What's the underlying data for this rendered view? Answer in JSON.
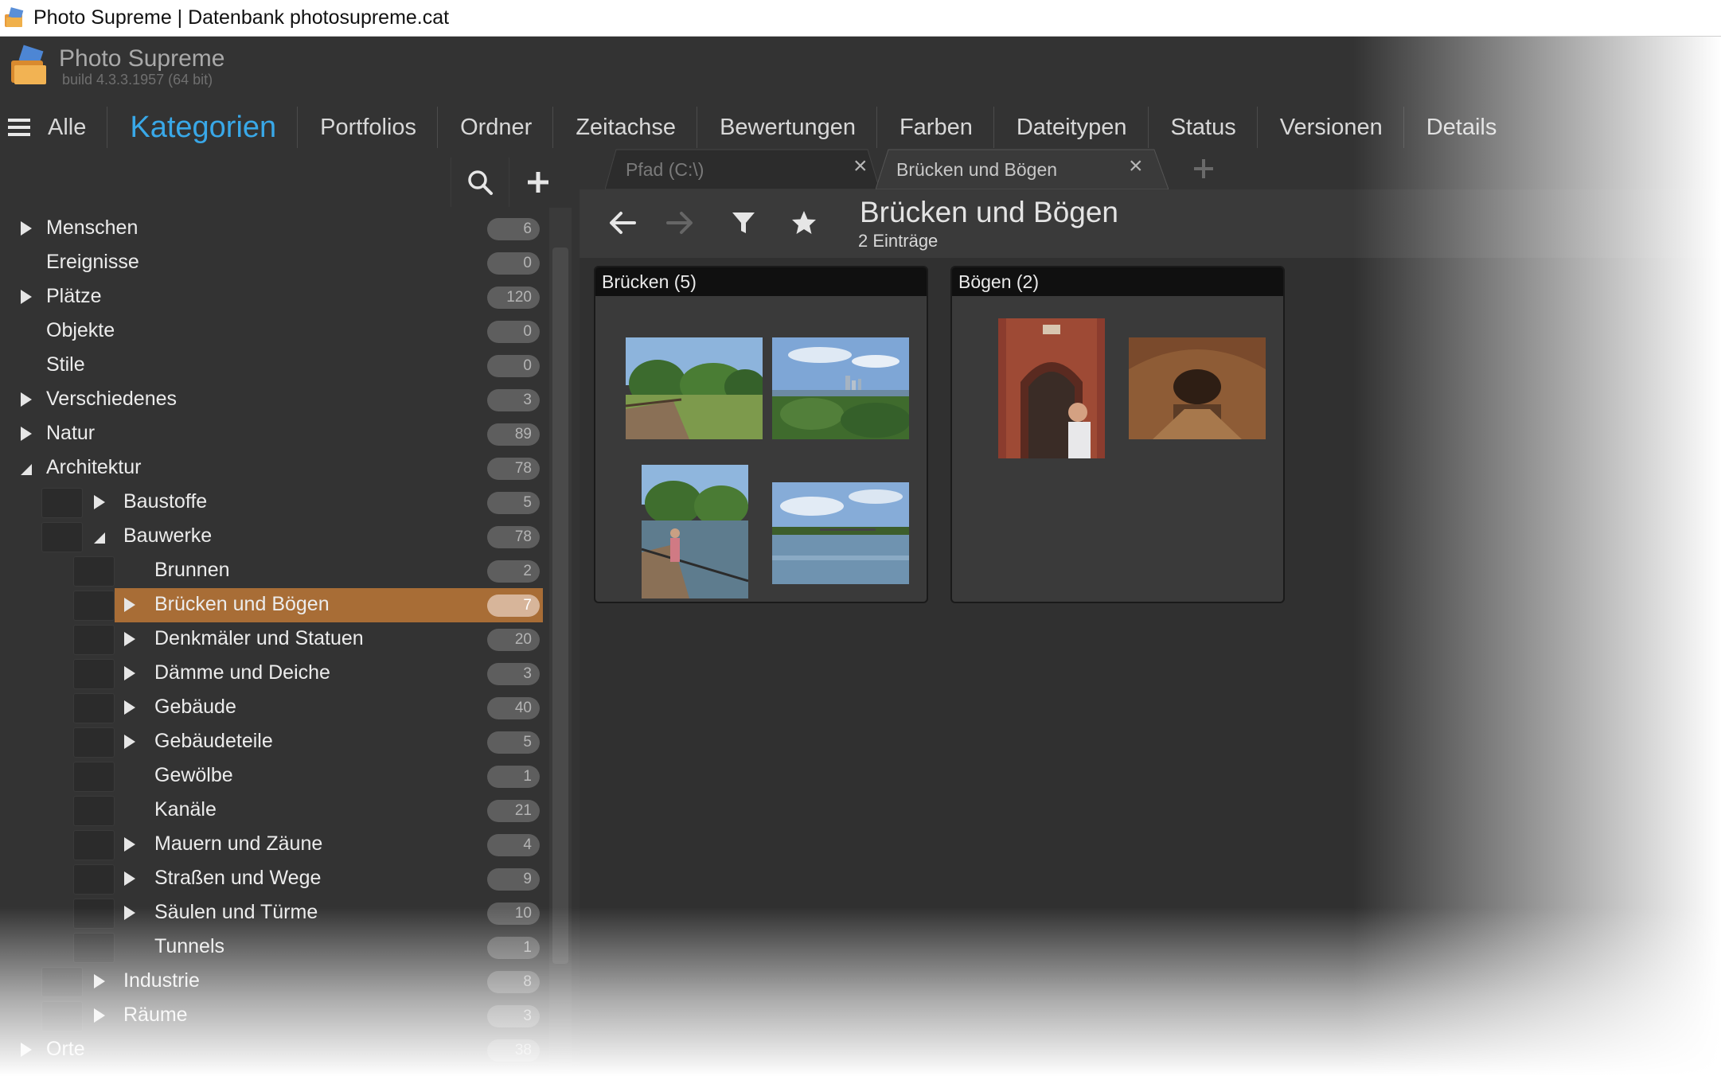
{
  "window": {
    "title": "Photo Supreme | Datenbank photosupreme.cat",
    "icon": "app-logo-icon"
  },
  "brand": {
    "name": "Photo Supreme",
    "build": "build 4.3.3.1957 (64 bit)"
  },
  "nav": {
    "menu_icon": "hamburger-icon",
    "items": [
      {
        "label": "Alle"
      },
      {
        "label": "Kategorien",
        "active": true
      },
      {
        "label": "Portfolios"
      },
      {
        "label": "Ordner"
      },
      {
        "label": "Zeitachse"
      },
      {
        "label": "Bewertungen"
      },
      {
        "label": "Farben"
      },
      {
        "label": "Dateitypen"
      },
      {
        "label": "Status"
      },
      {
        "label": "Versionen"
      },
      {
        "label": "Details"
      }
    ]
  },
  "left_tools": {
    "search_icon": "search-icon",
    "add_icon": "plus-icon"
  },
  "tree": [
    {
      "label": "Menschen",
      "count": "6",
      "level": 0,
      "expander": "collapsed"
    },
    {
      "label": "Ereignisse",
      "count": "0",
      "level": 0,
      "expander": "none"
    },
    {
      "label": "Plätze",
      "count": "120",
      "level": 0,
      "expander": "collapsed"
    },
    {
      "label": "Objekte",
      "count": "0",
      "level": 0,
      "expander": "none"
    },
    {
      "label": "Stile",
      "count": "0",
      "level": 0,
      "expander": "none"
    },
    {
      "label": "Verschiedenes",
      "count": "3",
      "level": 0,
      "expander": "collapsed"
    },
    {
      "label": "Natur",
      "count": "89",
      "level": 0,
      "expander": "collapsed"
    },
    {
      "label": "Architektur",
      "count": "78",
      "level": 0,
      "expander": "expanded"
    },
    {
      "label": "Baustoffe",
      "count": "5",
      "level": 1,
      "expander": "collapsed"
    },
    {
      "label": "Bauwerke",
      "count": "78",
      "level": 1,
      "expander": "expanded"
    },
    {
      "label": "Brunnen",
      "count": "2",
      "level": 2,
      "expander": "none"
    },
    {
      "label": "Brücken und Bögen",
      "count": "7",
      "level": 2,
      "expander": "collapsed",
      "selected": true
    },
    {
      "label": "Denkmäler und Statuen",
      "count": "20",
      "level": 2,
      "expander": "collapsed"
    },
    {
      "label": "Dämme und Deiche",
      "count": "3",
      "level": 2,
      "expander": "collapsed"
    },
    {
      "label": "Gebäude",
      "count": "40",
      "level": 2,
      "expander": "collapsed"
    },
    {
      "label": "Gebäudeteile",
      "count": "5",
      "level": 2,
      "expander": "collapsed"
    },
    {
      "label": "Gewölbe",
      "count": "1",
      "level": 2,
      "expander": "none"
    },
    {
      "label": "Kanäle",
      "count": "21",
      "level": 2,
      "expander": "none"
    },
    {
      "label": "Mauern und Zäune",
      "count": "4",
      "level": 2,
      "expander": "collapsed"
    },
    {
      "label": "Straßen und Wege",
      "count": "9",
      "level": 2,
      "expander": "collapsed"
    },
    {
      "label": "Säulen und Türme",
      "count": "10",
      "level": 2,
      "expander": "collapsed"
    },
    {
      "label": "Tunnels",
      "count": "1",
      "level": 2,
      "expander": "none"
    },
    {
      "label": "Industrie",
      "count": "8",
      "level": 1,
      "expander": "collapsed"
    },
    {
      "label": "Räume",
      "count": "3",
      "level": 1,
      "expander": "collapsed"
    },
    {
      "label": "Orte",
      "count": "38",
      "level": 0,
      "expander": "collapsed"
    }
  ],
  "tabs": [
    {
      "label": "Pfad (C:\\)",
      "active": false,
      "close_icon": "close-icon"
    },
    {
      "label": "Brücken und Bögen",
      "active": true,
      "close_icon": "close-icon"
    }
  ],
  "new_tab_icon": "plus-icon",
  "toolbar": {
    "back_icon": "arrow-left-icon",
    "forward_icon": "arrow-right-icon",
    "filter_icon": "filter-icon",
    "favorite_icon": "star-icon"
  },
  "content": {
    "title": "Brücken und Bögen",
    "subtitle": "2 Einträge",
    "groups": [
      {
        "label": "Brücken (5)",
        "thumbnails": [
          "park-walkway-photo",
          "city-skyline-river-photo",
          "person-on-boardwalk-photo",
          "river-bridge-photo"
        ]
      },
      {
        "label": "Bögen (2)",
        "thumbnails": [
          "brick-archway-photo",
          "vaulted-brick-tunnel-photo"
        ]
      }
    ]
  },
  "colors": {
    "app_bg": "#333333",
    "accent": "#39a8e8",
    "selection": "#a86d36",
    "count_pill": "#5e5e5e",
    "panel_header": "#101010"
  }
}
